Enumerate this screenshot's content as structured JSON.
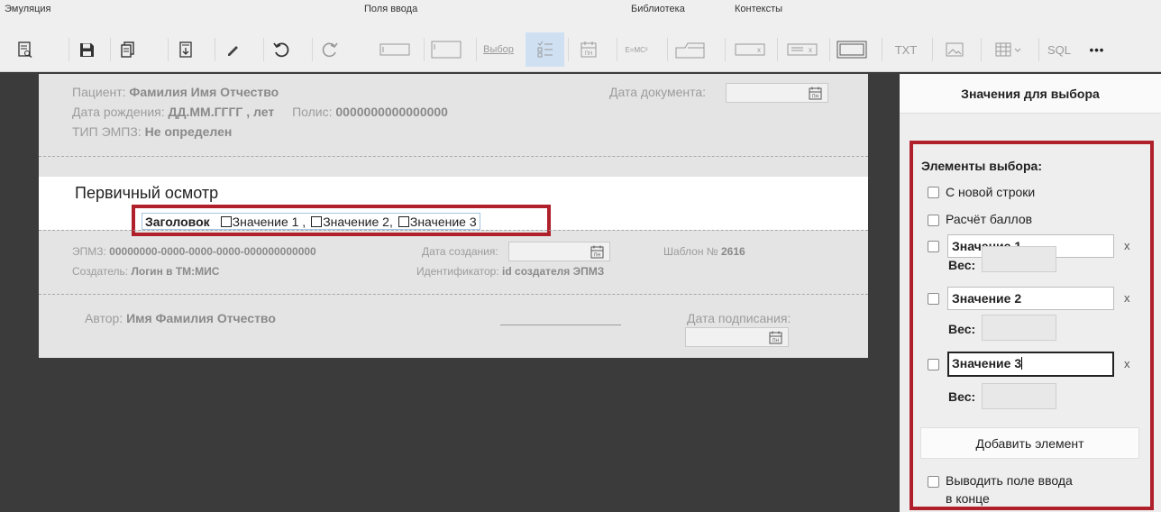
{
  "toolbar": {
    "groups": {
      "emulation": "Эмуляция",
      "input_fields": "Поля ввода",
      "library": "Библиотека",
      "contexts": "Контексты"
    },
    "buttons": {
      "choice": "Выбор",
      "formula": "E=MC²",
      "txt": "TXT",
      "sql": "SQL",
      "more": "•••",
      "cal": "ПН"
    }
  },
  "document": {
    "patient_label": "Пациент:",
    "patient_value": "Фамилия Имя Отчество",
    "dob_label": "Дата рождения:",
    "dob_value": "ДД.ММ.ГГГГ , лет",
    "policy_label": "Полис:",
    "policy_value": "0000000000000000",
    "type_label": "ТИП ЭМПЗ:",
    "type_value": "Не определен",
    "doc_date_label": "Дата документа:",
    "section_title": "Первичный осмотр",
    "checkbox_header": "Заголовок",
    "checkbox_values": [
      "Значение 1 ,",
      "Значение 2,",
      "Значение 3"
    ],
    "epmz_label": "ЭПМЗ:",
    "epmz_value": "00000000-0000-0000-0000-000000000000",
    "created_date_label": "Дата создания:",
    "template_label": "Шаблон №",
    "template_value": "2616",
    "creator_label": "Создатель:",
    "creator_value": "Логин в ТМ:МИС",
    "identifier_label": "Идентификатор:",
    "identifier_value": "id создателя ЭПМЗ",
    "author_label": "Автор:",
    "author_value": "Имя Фамилия Отчество",
    "signed_date_label": "Дата подписания:"
  },
  "panel": {
    "title": "Значения для выбора",
    "elements_label": "Элементы выбора:",
    "new_line_label": "С новой строки",
    "score_label": "Расчёт баллов",
    "items": [
      {
        "value": "Значение 1",
        "weight_label": "Вес:"
      },
      {
        "value": "Значение 2",
        "weight_label": "Вес:"
      },
      {
        "value": "Значение 3",
        "weight_label": "Вес:"
      }
    ],
    "remove_label": "x",
    "add_button": "Добавить элемент",
    "output_at_end_line1": "Выводить поле ввода",
    "output_at_end_line2": "в конце"
  }
}
